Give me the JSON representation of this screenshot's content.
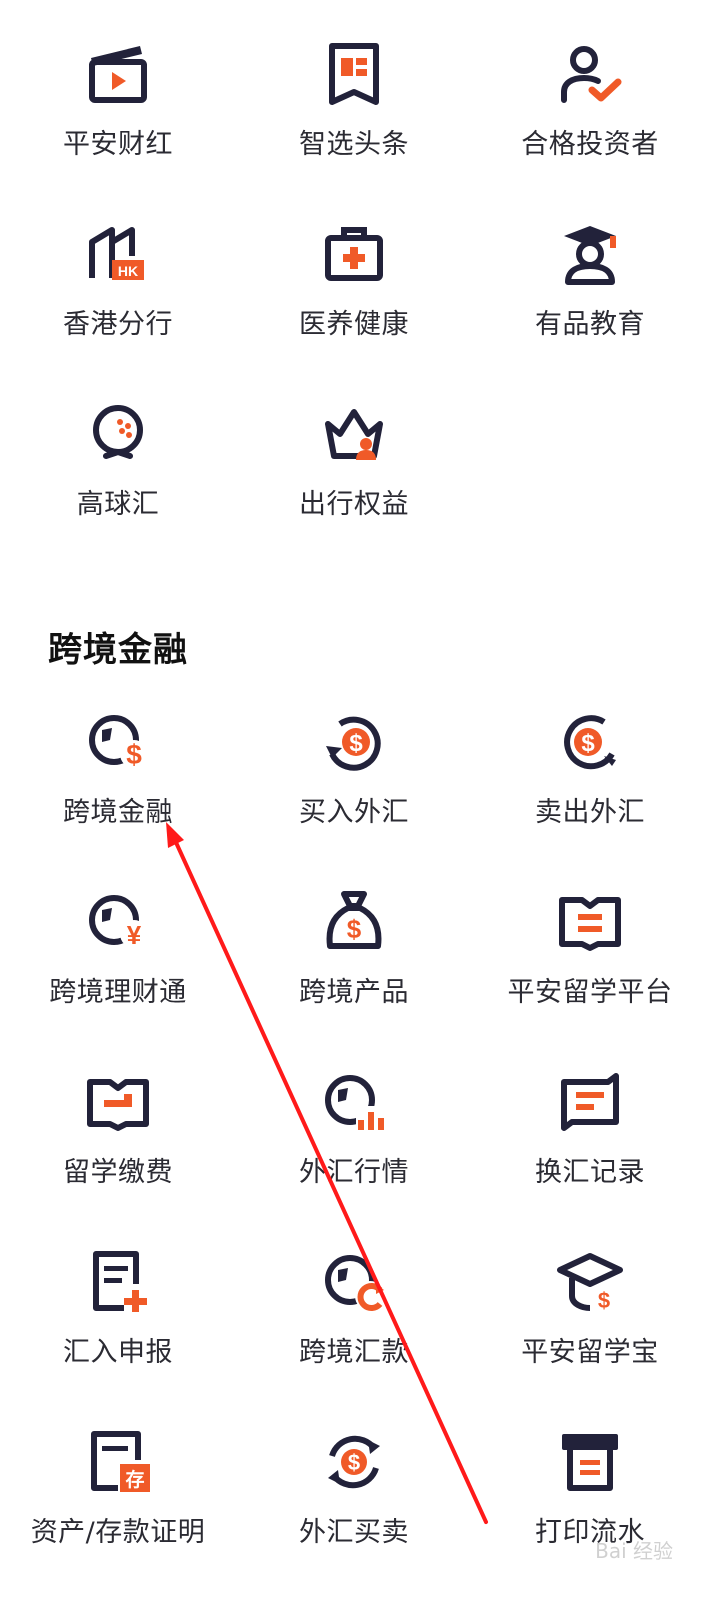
{
  "colors": {
    "icon_dark": "#22223a",
    "accent": "#f05a28",
    "text": "#2b2b33",
    "arrow": "#ff1a1a"
  },
  "top_items": [
    {
      "label": "平安财红",
      "icon": "clapperboard-play-icon"
    },
    {
      "label": "智选头条",
      "icon": "news-bookmark-icon"
    },
    {
      "label": "合格投资者",
      "icon": "user-check-icon"
    },
    {
      "label": "香港分行",
      "icon": "building-hk-icon"
    },
    {
      "label": "医养健康",
      "icon": "medical-kit-icon"
    },
    {
      "label": "有品教育",
      "icon": "graduate-icon"
    },
    {
      "label": "高球汇",
      "icon": "golf-ball-icon"
    },
    {
      "label": "出行权益",
      "icon": "crown-person-icon"
    }
  ],
  "section": {
    "title": "跨境金融"
  },
  "cross_items": [
    {
      "label": "跨境金融",
      "icon": "globe-dollar-icon"
    },
    {
      "label": "买入外汇",
      "icon": "dollar-cycle-in-icon"
    },
    {
      "label": "卖出外汇",
      "icon": "dollar-cycle-out-icon"
    },
    {
      "label": "跨境理财通",
      "icon": "globe-yen-icon"
    },
    {
      "label": "跨境产品",
      "icon": "money-bag-icon"
    },
    {
      "label": "平安留学平台",
      "icon": "open-book-icon"
    },
    {
      "label": "留学缴费",
      "icon": "book-payment-icon"
    },
    {
      "label": "外汇行情",
      "icon": "globe-chart-icon"
    },
    {
      "label": "换汇记录",
      "icon": "exchange-record-icon"
    },
    {
      "label": "汇入申报",
      "icon": "document-add-icon"
    },
    {
      "label": "跨境汇款",
      "icon": "globe-refresh-icon"
    },
    {
      "label": "平安留学宝",
      "icon": "grad-cap-dollar-icon"
    },
    {
      "label": "资产/存款证明",
      "icon": "deposit-certificate-icon"
    },
    {
      "label": "外汇买卖",
      "icon": "currency-swap-icon"
    },
    {
      "label": "打印流水",
      "icon": "printer-icon"
    }
  ],
  "watermark": "Bai 经验"
}
